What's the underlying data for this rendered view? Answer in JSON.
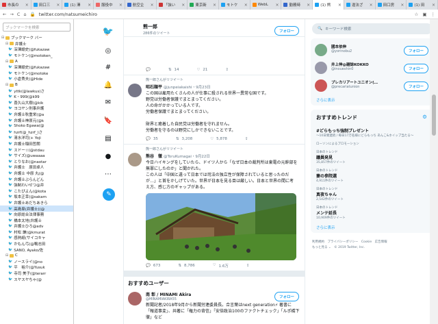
{
  "tabs": [
    {
      "label": "市長の",
      "color": "#d33"
    },
    {
      "label": "田口三",
      "color": "#1da1f2"
    },
    {
      "label": "(1) 澤",
      "color": "#1da1f2"
    },
    {
      "label": "服役中",
      "color": "#e66"
    },
    {
      "label": "航空企",
      "color": "#36c"
    },
    {
      "label": "「強い",
      "color": "#c33"
    },
    {
      "label": "東京新",
      "color": "#2a5"
    },
    {
      "label": "モトケ",
      "color": "#1da1f2"
    },
    {
      "label": "WebL",
      "color": "#f80"
    },
    {
      "label": "勤務時",
      "color": "#36c"
    },
    {
      "label": "(1) 熊",
      "color": "#1da1f2",
      "active": true
    },
    {
      "label": "違法ざ",
      "color": "#1da1f2"
    },
    {
      "label": "田口房",
      "color": "#1da1f2"
    },
    {
      "label": "(1) 田",
      "color": "#1da1f2"
    }
  ],
  "address": {
    "url": "twitter.com/natsumeichiro",
    "back": "←",
    "forward": "→",
    "reload": "C",
    "home": "⌂"
  },
  "bookmarks": {
    "search_placeholder": "ブックマークを検索",
    "items": [
      {
        "t": "ブックマーク バー",
        "k": "folder",
        "tog": "⊟"
      },
      {
        "t": "弁護士",
        "k": "folder",
        "tog": "⊟"
      },
      {
        "t": "深澤諭史(@fukazaw",
        "k": "bird"
      },
      {
        "t": "モトケン(@motoken_",
        "k": "bird"
      },
      {
        "t": "A",
        "k": "folder",
        "tog": "⊟"
      },
      {
        "t": "深澤諭史(@fukazaw",
        "k": "bird"
      },
      {
        "t": "モトケン(@motoke",
        "k": "bird"
      },
      {
        "t": "小倉秀夫(@Hide",
        "k": "bird"
      },
      {
        "t": "B",
        "k": "folder",
        "tog": "⊟"
      },
      {
        "t": "yttk(@lawkus)さ",
        "k": "bird"
      },
      {
        "t": "K・999(@k99",
        "k": "bird"
      },
      {
        "t": "喜久山大樹(@kik",
        "k": "bird"
      },
      {
        "t": "ヨコヤン刑事弁護",
        "k": "bird"
      },
      {
        "t": "弁護士秋重栄(@a",
        "k": "bird"
      },
      {
        "t": "弁護士神原元(@k",
        "k": "bird"
      },
      {
        "t": "Shoko Egawa(@",
        "k": "bird"
      },
      {
        "t": "hzrf(@_hzrf_)さ",
        "k": "bird"
      },
      {
        "t": "清水洋司(+ Yoji",
        "k": "bird"
      },
      {
        "t": "弁護士稲田哲朗",
        "k": "bird"
      },
      {
        "t": "スドー☆(@stdau",
        "k": "bird"
      },
      {
        "t": "サイズ(@uwaaaa",
        "k": "bird"
      },
      {
        "t": "とりなお(@naotar",
        "k": "bird"
      },
      {
        "t": "弁護士　原田卓人",
        "k": "bird"
      },
      {
        "t": "弁護士 中原 丸(@",
        "k": "bird"
      },
      {
        "t": "弁護士ぶらんどん",
        "k": "bird"
      },
      {
        "t": "強制わいせつ@弁",
        "k": "bird"
      },
      {
        "t": "こたぴよん(@kota",
        "k": "bird"
      },
      {
        "t": "坂本正幸(@sakam",
        "k": "bird"
      },
      {
        "t": "弁護士あだちあきら",
        "k": "bird"
      },
      {
        "t": "高島皐(弁護士)(@",
        "k": "bird",
        "sel": true
      },
      {
        "t": "向原総合法律事務",
        "k": "bird"
      },
      {
        "t": "橋本太地(弁護士",
        "k": "bird"
      },
      {
        "t": "弁護士ひろ@adv",
        "k": "bird"
      },
      {
        "t": "村松 謙(@kmurat",
        "k": "bird"
      },
      {
        "t": "感熱紙(サイコキャ",
        "k": "bird"
      },
      {
        "t": "かもん弓(@鴨志田",
        "k": "bird"
      },
      {
        "t": "SANO, Ayako/佐",
        "k": "bird"
      },
      {
        "t": "C",
        "k": "folder",
        "tog": "⊟"
      },
      {
        "t": "ノースライ(@no",
        "k": "bird"
      },
      {
        "t": "平　裕介(@Yusuk",
        "k": "bird"
      },
      {
        "t": "寺司 美子(@terarr",
        "k": "bird"
      },
      {
        "t": "スヤスヤちゃ(@",
        "k": "bird"
      }
    ]
  },
  "profile": {
    "name": "熊一郎",
    "tweets": "286件のツイート",
    "follow": "フォロー"
  },
  "top_acts": {
    "reply": "",
    "rt": "14",
    "like": "21"
  },
  "tweets": [
    {
      "rt": "熊一郎さんがリツイート",
      "name": "昭石順平",
      "handle": "@junpeiakaishi・9月23日",
      "body": [
        "この国は雇用たくさんの人が仕事に殺される世界一異常な国です。",
        "野党は労働者保護でまとまってください。",
        "人の命がかかっている人です。",
        "労働者保護でまとまってください。",
        "",
        "財界と癒着した自民党は労働者を守れません。",
        "労働者を守るのは野党にしかできないことです。"
      ],
      "reply": "35",
      "retweet": "3,208",
      "like": "5,878"
    },
    {
      "rt": "熊一郎さんがリツイート",
      "name": "熊谷　徹",
      "handle": "@ToruKumagai・9月22日",
      "body": [
        "今日ハイキングをしていたら、ドイツ人から「なぜ日本の裁判所は東電の元幹部を",
        "無罪にしたのか」と聞かれた。",
        "この人は「中国と違って日本では司法の独立性が保障されていると思ったのだ",
        "が…」と首をかしげていた。世界が日本を見る目は厳しい。日本と世界の間に考",
        "え方、感じ方のギャップがある。"
      ],
      "reply": "673",
      "retweet": "8,786",
      "like": "1.6万"
    }
  ],
  "reco": {
    "header": "おすすめユーザー",
    "name": "南 彰 / MINAMI Akira",
    "handle": "@MINAMIAKIRA55",
    "follow": "フォロー",
    "body": [
      "新聞記者/2018年9月から新聞労連委員長。合言葉はnext generation⚡ 著書に",
      "「報道事変」、共著に「権力の背信」「安倍政治100のファクトチェック」「ルポ橋下",
      "徹」など"
    ]
  },
  "sidebar": {
    "search_placeholder": "キーワード検索",
    "users": [
      {
        "name": "國本依伸",
        "handle": "@yorinobu2",
        "follow": "フォロー"
      },
      {
        "name": "井上伸@雑誌KOKKO",
        "handle": "@inoueshin0",
        "follow": "フォロー"
      },
      {
        "name": "プレカリアートユニオン(…",
        "handle": "@precariatunion",
        "follow": "フォロー"
      }
    ],
    "more": "さらに表示",
    "trends_header": "おすすめトレンド",
    "trends": [
      {
        "t1": "",
        "t2": "#どらもっち強制プレゼント",
        "t3": "〜10日間連続 / 毎日17万名様にどらもっち あんこ&ホイップ当たる〜"
      },
      {
        "t1": "",
        "t2": "",
        "t3": "ローソンによるプロモーション"
      },
      {
        "t1": "日本のトレンド",
        "t2": "議員発見",
        "t3": "35,857件のツイート"
      },
      {
        "t1": "日本のトレンド",
        "t2": "妻の参院選",
        "t3": "4,911件のツイート"
      },
      {
        "t1": "日本のトレンド",
        "t2": "真夜ちゃん",
        "t3": "2,542件のツイート"
      },
      {
        "t1": "日本のトレンド",
        "t2": "メンテ延長",
        "t3": "10,909件のツイート"
      }
    ],
    "trends_more": "さらに表示",
    "footer": [
      "利用規約　プライバシーポリシー　Cookie　広告情報",
      "もっと見る ⌄　© 2019 Twitter, Inc."
    ]
  }
}
